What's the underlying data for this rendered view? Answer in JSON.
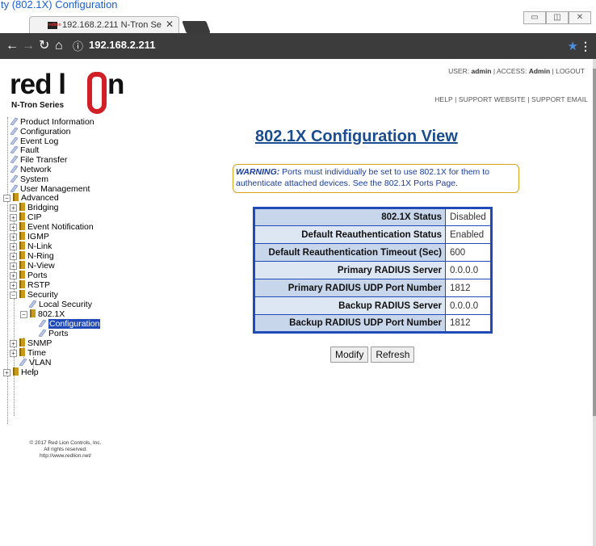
{
  "browser": {
    "top_strip_text": "ty (802.1X) Configuration",
    "tab_title": "192.168.2.211 N-Tron Se",
    "favicon_text": "redlion",
    "url": "192.168.2.211"
  },
  "header": {
    "logo_red": "red l",
    "logo_on": "n",
    "logo_series": "N-Tron Series",
    "user_label": "USER:",
    "user_value": "admin",
    "access_label": "ACCESS:",
    "access_value": "Admin",
    "logout": "LOGOUT",
    "help": "HELP",
    "support_website": "SUPPORT WEBSITE",
    "support_email": "SUPPORT EMAIL"
  },
  "tree": {
    "product_information": "Product Information",
    "configuration": "Configuration",
    "event_log": "Event Log",
    "fault": "Fault",
    "file_transfer": "File Transfer",
    "network": "Network",
    "system": "System",
    "user_management": "User Management",
    "advanced": "Advanced",
    "bridging": "Bridging",
    "cip": "CIP",
    "event_notification": "Event Notification",
    "igmp": "IGMP",
    "n_link": "N-Link",
    "n_ring": "N-Ring",
    "n_view": "N-View",
    "ports": "Ports",
    "rstp": "RSTP",
    "security": "Security",
    "local_security": "Local Security",
    "dot1x": "802.1X",
    "dot1x_configuration": "Configuration",
    "dot1x_ports": "Ports",
    "snmp": "SNMP",
    "time": "Time",
    "vlan": "VLAN",
    "help": "Help"
  },
  "copyright": {
    "line1": "© 2017 Red Lion Controls, Inc.",
    "line2": "All rights reserved.",
    "line3": "http://www.redlion.net/"
  },
  "main": {
    "title": "802.1X Configuration View",
    "warning_label": "WARNING:",
    "warning_text": "Ports must individually be set to use 802.1X for them to authenticate attached devices. See the 802.1X Ports Page.",
    "rows": [
      {
        "label": "802.1X Status",
        "value": "Disabled"
      },
      {
        "label": "Default Reauthentication Status",
        "value": "Enabled"
      },
      {
        "label": "Default Reauthentication Timeout (Sec)",
        "value": "600"
      },
      {
        "label": "Primary RADIUS Server",
        "value": "0.0.0.0"
      },
      {
        "label": "Primary RADIUS UDP Port Number",
        "value": "1812"
      },
      {
        "label": "Backup RADIUS Server",
        "value": "0.0.0.0"
      },
      {
        "label": "Backup RADIUS UDP Port Number",
        "value": "1812"
      }
    ],
    "modify_label": "Modify",
    "refresh_label": "Refresh"
  }
}
